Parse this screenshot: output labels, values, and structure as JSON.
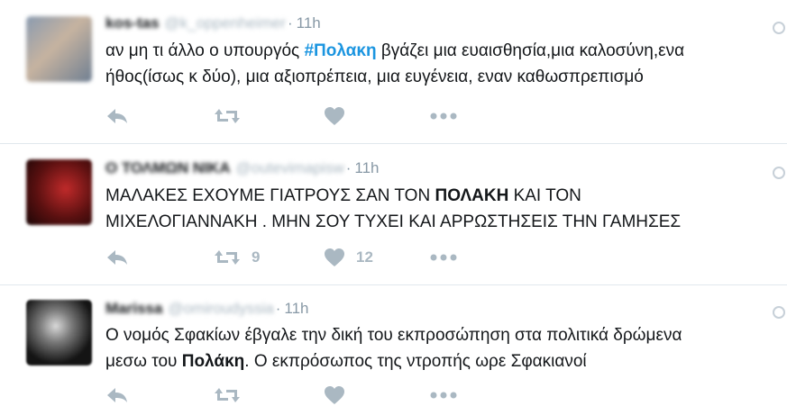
{
  "tweets": [
    {
      "name": "kos-tas",
      "handle": "@k_oppenheimer",
      "time": "11h",
      "lines": [
        [
          {
            "t": "αν μη τι άλλο ο υπουργός ",
            "s": ""
          },
          {
            "t": "#Πολακη",
            "s": "hashtag"
          },
          {
            "t": " βγάζει μια ευαισθησία,μια καλοσύνη,ενα",
            "s": ""
          }
        ],
        [
          {
            "t": "ήθος(ίσως κ δύο), μια αξιοπρέπεια, μια ευγένεια, εναν καθωσπρεπισμό",
            "s": ""
          }
        ]
      ],
      "retweets": "",
      "likes": ""
    },
    {
      "name": "Ο ΤΟΛΜΩΝ ΝΙΚΑ",
      "handle": "@outevimapisw",
      "time": "11h",
      "lines": [
        [
          {
            "t": "ΜΑΛΑΚΕΣ ΕΧΟΥΜΕ ΓΙΑΤΡΟΥΣ ΣΑΝ ΤΟΝ ",
            "s": ""
          },
          {
            "t": "ΠΟΛΑΚΗ",
            "s": "bold"
          },
          {
            "t": " ΚΑΙ ΤΟΝ",
            "s": ""
          }
        ],
        [
          {
            "t": "ΜΙΧΕΛΟΓΙΑΝΝΑΚΗ . ΜΗΝ ΣΟΥ ΤΥΧΕΙ ΚΑΙ ΑΡΡΩΣΤΗΣΕΙΣ ΤΗΝ ΓΑΜΗΣΕΣ",
            "s": ""
          }
        ]
      ],
      "retweets": "9",
      "likes": "12"
    },
    {
      "name": "Marissa",
      "handle": "@omiroudyssia",
      "time": "11h",
      "lines": [
        [
          {
            "t": "Ο νομός Σφακίων έβγαλε την δική του εκπροσώπηση στα πολιτικά δρώμενα",
            "s": ""
          }
        ],
        [
          {
            "t": "μεσω του ",
            "s": ""
          },
          {
            "t": "Πολάκη",
            "s": "bold"
          },
          {
            "t": ". Ο εκπρόσωπος της ντροπής ωρε Σφακιανοί",
            "s": ""
          }
        ]
      ],
      "retweets": "",
      "likes": ""
    }
  ],
  "colors": {
    "hashtag": "#1b95e0",
    "meta": "#8899a6",
    "icon": "#aab8c2",
    "divider": "#e1e8ed"
  },
  "icons": [
    "reply-icon",
    "retweet-icon",
    "heart-icon",
    "more-icon",
    "globe-icon"
  ]
}
